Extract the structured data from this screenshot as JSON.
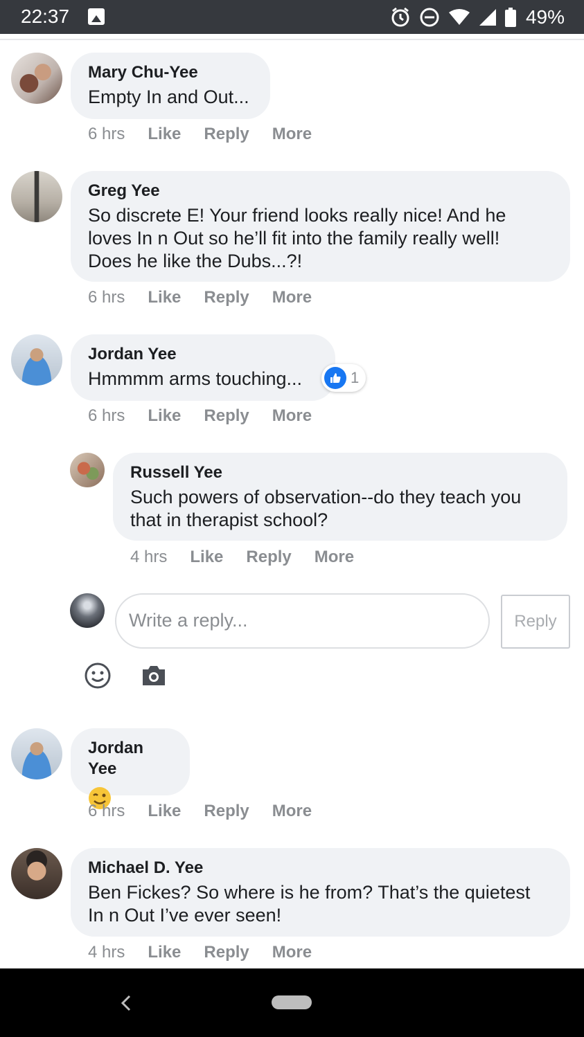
{
  "status_bar": {
    "time": "22:37",
    "battery": "49%",
    "icons": [
      "gallery-icon",
      "alarm-icon",
      "do-not-disturb-icon",
      "wifi-icon",
      "cell-signal-icon",
      "battery-icon"
    ]
  },
  "comments": [
    {
      "name": "Mary Chu-Yee",
      "text": "Empty In and Out...",
      "time": "6 hrs",
      "like": "Like",
      "reply": "Reply",
      "more": "More"
    },
    {
      "name": "Greg Yee",
      "lines": [
        "So discrete E! Your friend looks really nice! And he",
        "loves In n Out so he’ll fit into the family really well!",
        "Does he like the Dubs...?!"
      ],
      "time": "6 hrs",
      "like": "Like",
      "reply": "Reply",
      "more": "More"
    },
    {
      "name": "Jordan Yee",
      "text": "Hmmmm arms touching...",
      "time": "6 hrs",
      "like": "Like",
      "reply": "Reply",
      "more": "More",
      "reaction_count": "1"
    },
    {
      "name": "Russell Yee",
      "lines": [
        "Such powers of observation--do they teach you",
        "that in therapist school?"
      ],
      "time": "4 hrs",
      "like": "Like",
      "reply": "Reply",
      "more": "More"
    },
    {
      "name": "Jordan Yee",
      "emoji": "wink-emoji",
      "time": "6 hrs",
      "like": "Like",
      "reply": "Reply",
      "more": "More"
    },
    {
      "name": "Michael D. Yee",
      "lines": [
        "Ben Fickes? So where is he from? That’s the quietest",
        "In n Out I’ve ever seen!"
      ],
      "time": "4 hrs",
      "like": "Like",
      "reply": "Reply",
      "more": "More"
    }
  ],
  "reply_box": {
    "placeholder": "Write a reply...",
    "button": "Reply"
  },
  "colors": {
    "bubble": "#f0f2f5",
    "meta_text": "#8a8d91",
    "like_blue": "#1877f2",
    "status_bar": "#36393e"
  }
}
